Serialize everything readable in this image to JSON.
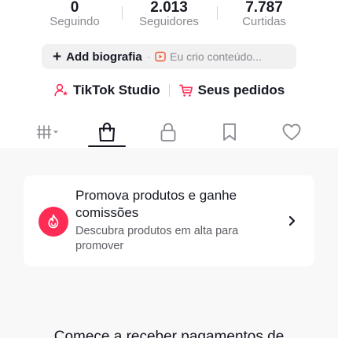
{
  "stats": [
    {
      "value": "0",
      "label": "Seguindo"
    },
    {
      "value": "2.013",
      "label": "Seguidores"
    },
    {
      "value": "7.787",
      "label": "Curtidas"
    }
  ],
  "bio": {
    "add_label": "Add biografia",
    "separator": "·",
    "placeholder": "Eu crio conteúdo..."
  },
  "links": {
    "studio_label": "TikTok Studio",
    "orders_label": "Seus pedidos"
  },
  "tabs": [
    {
      "icon": "grid-filter-icon",
      "active": false
    },
    {
      "icon": "shopping-bag-icon",
      "active": true
    },
    {
      "icon": "lock-icon",
      "active": false
    },
    {
      "icon": "bookmark-icon",
      "active": false
    },
    {
      "icon": "heart-icon",
      "active": false
    }
  ],
  "promo": {
    "title": "Promova produtos e ganhe comissões",
    "subtitle": "Descubra produtos em alta para promover",
    "icon": "flame-icon"
  },
  "bottom_text": "Comece a receber pagamentos de",
  "colors": {
    "accent": "#fe2c55",
    "text": "#161823",
    "muted": "#8a8b91",
    "background_muted": "#f8f8f8"
  }
}
